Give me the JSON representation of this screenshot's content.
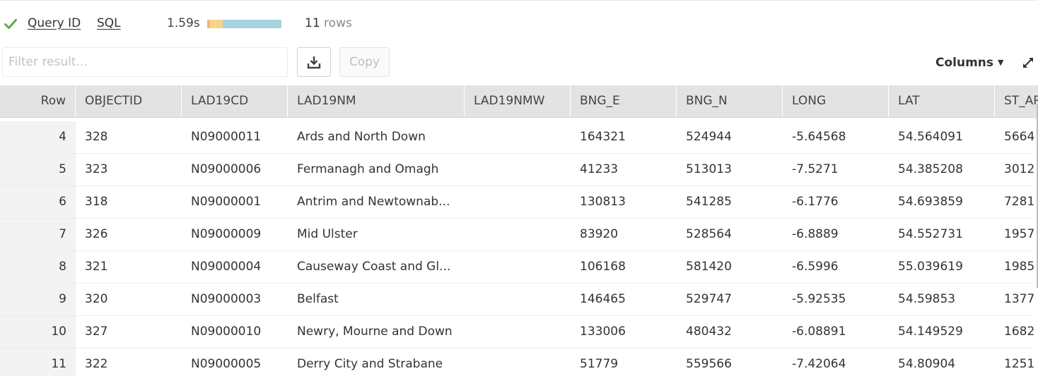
{
  "status": {
    "query_id_label": "Query ID",
    "sql_label": "SQL",
    "duration": "1.59s",
    "timing_segments": [
      {
        "fraction": 0.04,
        "color": "#f0b87a"
      },
      {
        "fraction": 0.17,
        "color": "#f6d58a"
      },
      {
        "fraction": 0.79,
        "color": "#a5d3df"
      }
    ],
    "rows_count": "11",
    "rows_unit": "rows",
    "success_color": "#5aab46"
  },
  "toolbar": {
    "filter_placeholder": "Filter result...",
    "download_icon": "download-icon",
    "copy_label": "Copy",
    "columns_label": "Columns",
    "columns_caret": "▼",
    "expand_icon": "expand-icon"
  },
  "table": {
    "columns": [
      "Row",
      "OBJECTID",
      "LAD19CD",
      "LAD19NM",
      "LAD19NMW",
      "BNG_E",
      "BNG_N",
      "LONG",
      "LAT",
      "ST_AR"
    ],
    "rows": [
      [
        "4",
        "328",
        "N09000011",
        "Ards and North Down",
        "",
        "164321",
        "524944",
        "-5.64568",
        "54.564091",
        "5664"
      ],
      [
        "5",
        "323",
        "N09000006",
        "Fermanagh and Omagh",
        "",
        "41233",
        "513013",
        "-7.5271",
        "54.385208",
        "3012"
      ],
      [
        "6",
        "318",
        "N09000001",
        "Antrim and Newtownab...",
        "",
        "130813",
        "541285",
        "-6.1776",
        "54.693859",
        "7281"
      ],
      [
        "7",
        "326",
        "N09000009",
        "Mid Ulster",
        "",
        "83920",
        "528564",
        "-6.8889",
        "54.552731",
        "1957"
      ],
      [
        "8",
        "321",
        "N09000004",
        "Causeway Coast and Gl...",
        "",
        "106168",
        "581420",
        "-6.5996",
        "55.039619",
        "1985"
      ],
      [
        "9",
        "320",
        "N09000003",
        "Belfast",
        "",
        "146465",
        "529747",
        "-5.92535",
        "54.59853",
        "1377"
      ],
      [
        "10",
        "327",
        "N09000010",
        "Newry, Mourne and Down",
        "",
        "133006",
        "480432",
        "-6.08891",
        "54.149529",
        "1682"
      ],
      [
        "11",
        "322",
        "N09000005",
        "Derry City and Strabane",
        "",
        "51779",
        "559566",
        "-7.42064",
        "54.80904",
        "1251"
      ]
    ]
  }
}
